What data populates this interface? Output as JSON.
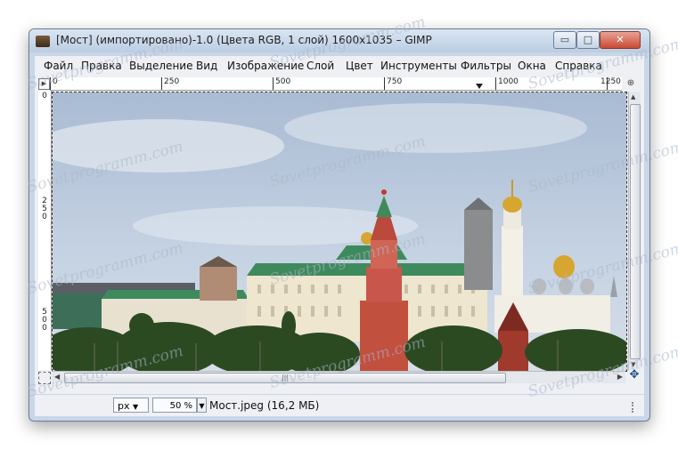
{
  "window": {
    "title": "[Мост] (импортировано)-1.0 (Цвета RGB, 1 слой) 1600x1035 – GIMP",
    "minimize_glyph": "▭",
    "maximize_glyph": "□",
    "close_glyph": "✕"
  },
  "menu": {
    "items": [
      "Файл",
      "Правка",
      "Выделение",
      "Вид",
      "Изображение",
      "Слой",
      "Цвет",
      "Инструменты",
      "Фильтры",
      "Окна",
      "Справка"
    ]
  },
  "ruler": {
    "horizontal_labels": [
      "0",
      "250",
      "500",
      "750",
      "1000",
      "1250"
    ],
    "vertical_labels": [
      "0",
      "250",
      "500"
    ]
  },
  "canvas": {
    "nav_glyph": "▶",
    "zoom_corner_glyph": "⊕",
    "hscroll_grip": "|||",
    "navigate_glyph": "✥"
  },
  "status": {
    "unit": "px",
    "zoom": "50 %",
    "file_info": "Мост.jpeg (16,2 МБ)"
  },
  "watermark": {
    "text": "Sovetprogramm.com"
  },
  "icons": {
    "app": "gimp-app-icon",
    "nav": "navigate-play-icon",
    "zoom": "zoom-to-fit-icon",
    "navigate": "navigate-cross-icon",
    "dropdown": "chevron-down-icon"
  },
  "colors": {
    "sky": "#b7c6da",
    "kremlin_tower": "#c2503e",
    "palace_roof": "#3f8a5d",
    "dome_gold": "#d7a631",
    "trees": "#2c4a22"
  }
}
